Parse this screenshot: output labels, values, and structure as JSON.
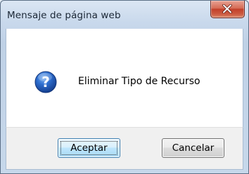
{
  "dialog": {
    "title": "Mensaje de página web",
    "message": "Eliminar Tipo de Recurso",
    "icon": "question-icon",
    "close_icon": "close-icon"
  },
  "buttons": {
    "ok_label": "Aceptar",
    "cancel_label": "Cancelar"
  },
  "colors": {
    "close_button": "#c2402a",
    "icon_blue": "#1f57b8"
  }
}
